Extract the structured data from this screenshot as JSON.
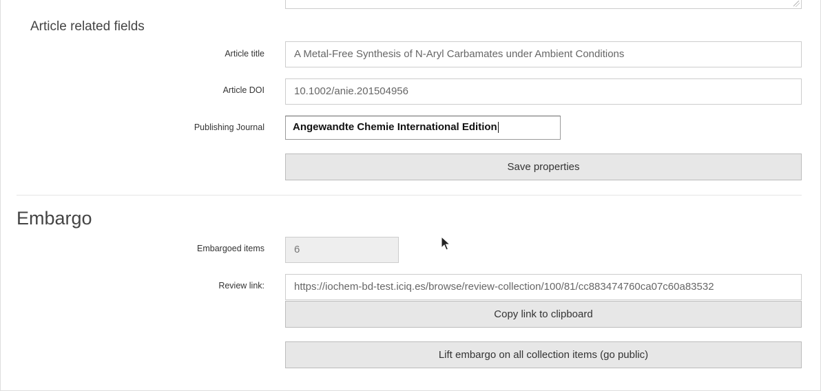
{
  "article_section": {
    "title": "Article related fields",
    "fields": {
      "title_label": "Article title",
      "title_value": "A Metal-Free Synthesis of N-Aryl Carbamates under Ambient Conditions",
      "doi_label": "Article DOI",
      "doi_value": "10.1002/anie.201504956",
      "journal_label": "Publishing Journal",
      "journal_value": "Angewandte Chemie International Edition"
    },
    "save_button_label": "Save properties"
  },
  "embargo_section": {
    "title": "Embargo",
    "embargoed_items_label": "Embargoed items",
    "embargoed_items_value": "6",
    "review_link_label": "Review link:",
    "review_link_value": "https://iochem-bd-test.iciq.es/browse/review-collection/100/81/cc883474760ca07c60a83532",
    "copy_button_label": "Copy link to clipboard",
    "lift_button_label": "Lift embargo on all collection items (go public)"
  }
}
